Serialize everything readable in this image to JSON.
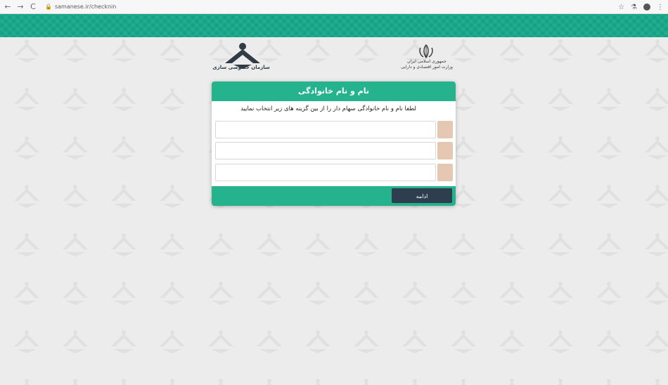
{
  "browser": {
    "url": "samanese.ir/checknin",
    "back_glyph": "←",
    "forward_glyph": "→",
    "reload_glyph": "C",
    "lock_glyph": "🔒",
    "star_glyph": "☆",
    "ext_glyph": "⚗",
    "menu_glyph": "⋮"
  },
  "header": {
    "left_logo_text": "سازمان خصوصی سازی",
    "emblem_text_line1": "جمهوری اسلامی ایران",
    "emblem_text_line2": "وزارت امور اقتصادی و دارایی"
  },
  "card": {
    "title": "نام و نام خانوادگی",
    "subtitle": "لطفا نام و نام خانوادگی سهام دار را از بین گزینه های زیر انتخاب نمایید",
    "options": [
      "",
      "",
      ""
    ],
    "continue_label": "ادامه"
  },
  "colors": {
    "teal": "#25b38e",
    "band": "#16a98a",
    "button": "#2e3e4e",
    "tag": "#e6c7b2",
    "background": "#ececec"
  }
}
